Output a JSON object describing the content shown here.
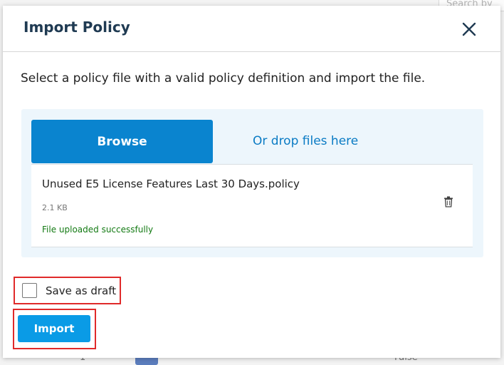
{
  "background": {
    "search_placeholder": "Search by",
    "row_number": "1",
    "row_value": "False"
  },
  "dialog": {
    "title": "Import Policy",
    "close_icon": "close-icon",
    "description": "Select a policy file with a valid policy definition and import the file.",
    "dropzone": {
      "browse_label": "Browse",
      "drop_text": "Or drop files here"
    },
    "file": {
      "name": "Unused E5 License Features Last 30 Days.policy",
      "size": "2.1 KB",
      "status": "File uploaded successfully",
      "delete_icon": "trash-icon"
    },
    "save_as_draft": {
      "label": "Save as draft",
      "checked": false
    },
    "import_label": "Import"
  },
  "colors": {
    "accent": "#0a84cf",
    "import_button": "#0a9be6",
    "success": "#137a13",
    "highlight_border": "#e02a2a",
    "dropzone_bg": "#edf6fc"
  }
}
